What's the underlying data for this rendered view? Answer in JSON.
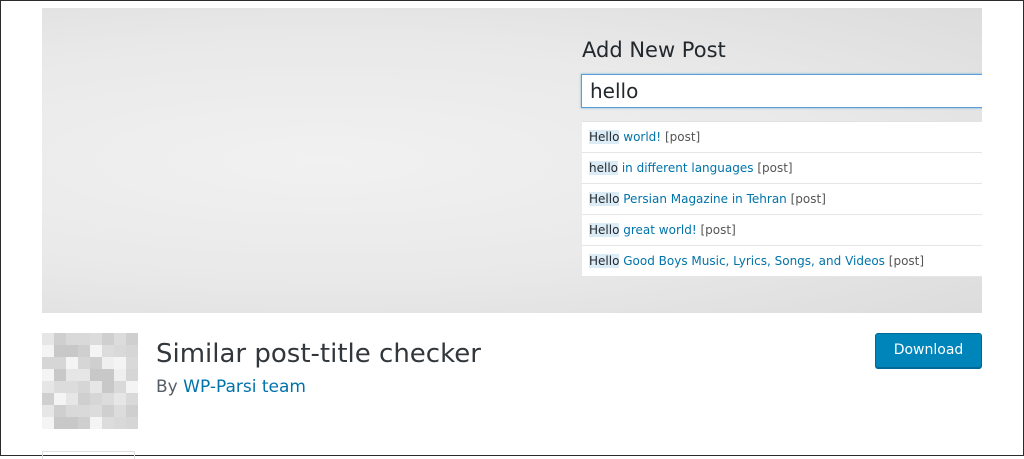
{
  "screenshot": {
    "panel_title": "Add New Post",
    "title_input_value": "hello",
    "suggestions": [
      {
        "match": "Hello",
        "rest": "world!",
        "tag": "[post]"
      },
      {
        "match": "hello",
        "rest": "in different languages",
        "tag": "[post]"
      },
      {
        "match": "Hello",
        "rest": "Persian Magazine in Tehran",
        "tag": "[post]"
      },
      {
        "match": "Hello",
        "rest": "great world!",
        "tag": "[post]"
      },
      {
        "match": "Hello",
        "rest": "Good Boys Music, Lyrics, Songs, and Videos",
        "tag": "[post]"
      }
    ]
  },
  "plugin": {
    "name": "Similar post-title checker",
    "by_prefix": "By",
    "author": "WP-Parsi team",
    "download_label": "Download",
    "thumbnail_icon": "pixelated-thumbnail-icon"
  },
  "colors": {
    "accent": "#0073aa",
    "button": "#0085ba",
    "highlight": "#dcecf7"
  }
}
